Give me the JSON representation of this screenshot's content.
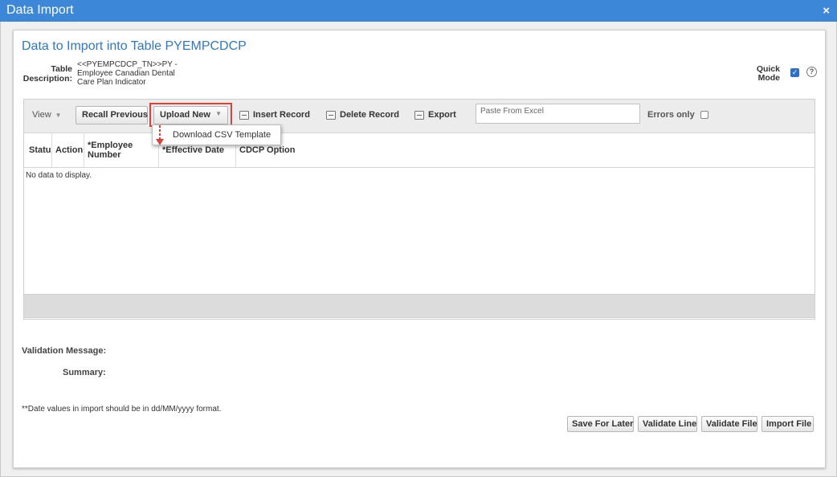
{
  "window": {
    "title": "Data Import",
    "close_icon": "×"
  },
  "page": {
    "title": "Data to Import into Table PYEMPCDCP",
    "table_desc_label": "Table Description:",
    "table_desc_value": "<<PYEMPCDCP_TN>>PY - Employee Canadian Dental Care Plan Indicator",
    "quick_mode_label": "Quick Mode",
    "quick_mode_checked": true,
    "help_icon": "?"
  },
  "toolbar": {
    "view": "View",
    "recall_previous": "Recall Previous",
    "upload_new": "Upload New",
    "insert_record": "Insert Record",
    "delete_record": "Delete Record",
    "export": "Export",
    "paste_placeholder": "Paste From Excel",
    "errors_only": "Errors only",
    "errors_only_checked": false
  },
  "dropdown": {
    "items": [
      "Download CSV Template"
    ]
  },
  "grid": {
    "columns": [
      "Status",
      "Action",
      "*Employee Number",
      "*Effective Date",
      "CDCP Option"
    ],
    "empty_text": "No data to display."
  },
  "footer": {
    "validation_message_label": "Validation Message:",
    "summary_label": "Summary:",
    "date_note": "**Date values in import should be in dd/MM/yyyy format.",
    "buttons": [
      "Save For Later",
      "Validate Line",
      "Validate File",
      "Import File"
    ]
  },
  "colors": {
    "title_bar": "#3c87d8",
    "highlight": "#d9433c",
    "link_title": "#2f78c4"
  }
}
